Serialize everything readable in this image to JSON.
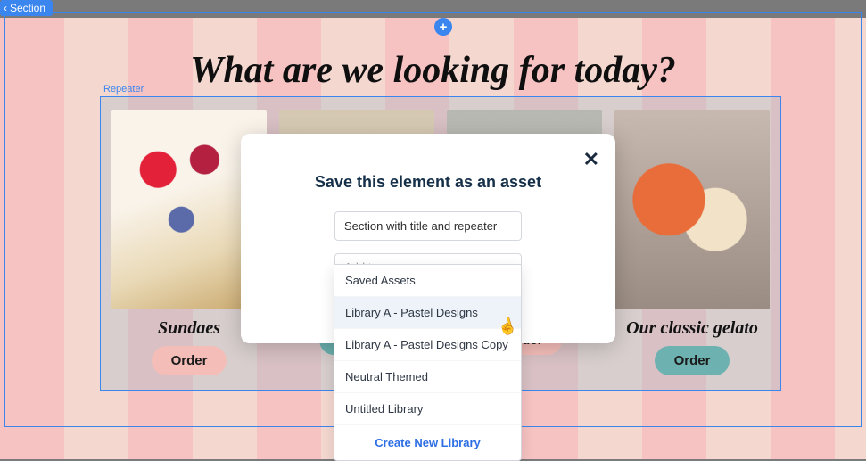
{
  "section_tab_label": "Section",
  "headline": "What are we looking for today?",
  "repeater_label": "Repeater",
  "cards": [
    {
      "title": "Sundaes",
      "button": "Order",
      "variant": "pink"
    },
    {
      "title": "",
      "button": "Order",
      "variant": "teal"
    },
    {
      "title": "",
      "button": "Order",
      "variant": "pink"
    },
    {
      "title": "Our classic gelato",
      "button": "Order",
      "variant": "teal"
    }
  ],
  "modal": {
    "title": "Save this element as an asset",
    "input_value": "Section with title and repeater",
    "select_placeholder": "Add to"
  },
  "dropdown": {
    "options": [
      "Saved Assets",
      "Library A - Pastel Designs",
      "Library A - Pastel Designs Copy",
      "Neutral Themed",
      "Untitled Library"
    ],
    "hovered_index": 1,
    "create_label": "Create New Library"
  }
}
